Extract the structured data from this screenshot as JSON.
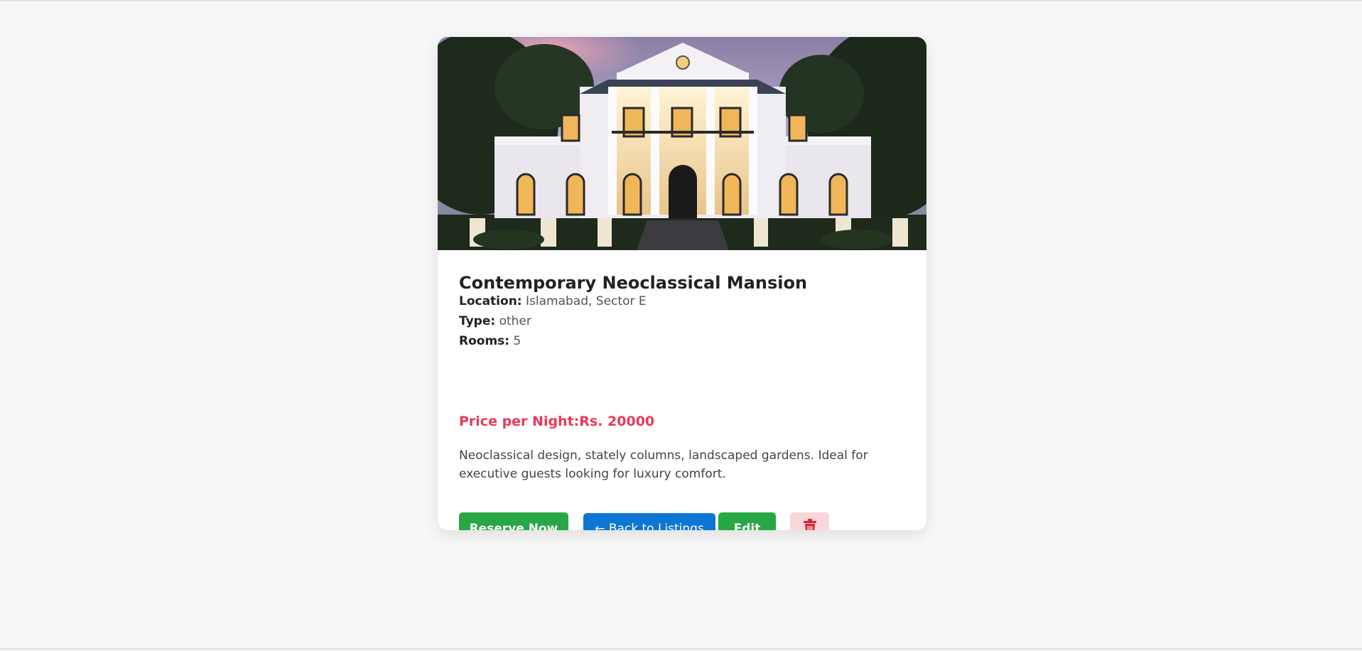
{
  "listing": {
    "title": "Contemporary Neoclassical Mansion",
    "location_label": "Location:",
    "location_value": "Islamabad, Sector E",
    "type_label": "Type:",
    "type_value": "other",
    "rooms_label": "Rooms:",
    "rooms_value": "5",
    "price": "Price per Night:Rs. 20000",
    "description": "Neoclassical design, stately columns, landscaped gardens. Ideal for executive guests looking for luxury comfort."
  },
  "actions": {
    "reserve_label": "Reserve Now",
    "back_label": "← Back to Listings",
    "edit_label": "Edit",
    "delete_icon": "trash-icon"
  },
  "colors": {
    "background": "#f7f7f7",
    "price_accent": "#e8395a",
    "reserve_button": "#28a745",
    "back_button": "#0d76d4",
    "edit_button": "#28a745",
    "delete_button_bg": "#f8d7da",
    "delete_icon": "#d9233a"
  }
}
